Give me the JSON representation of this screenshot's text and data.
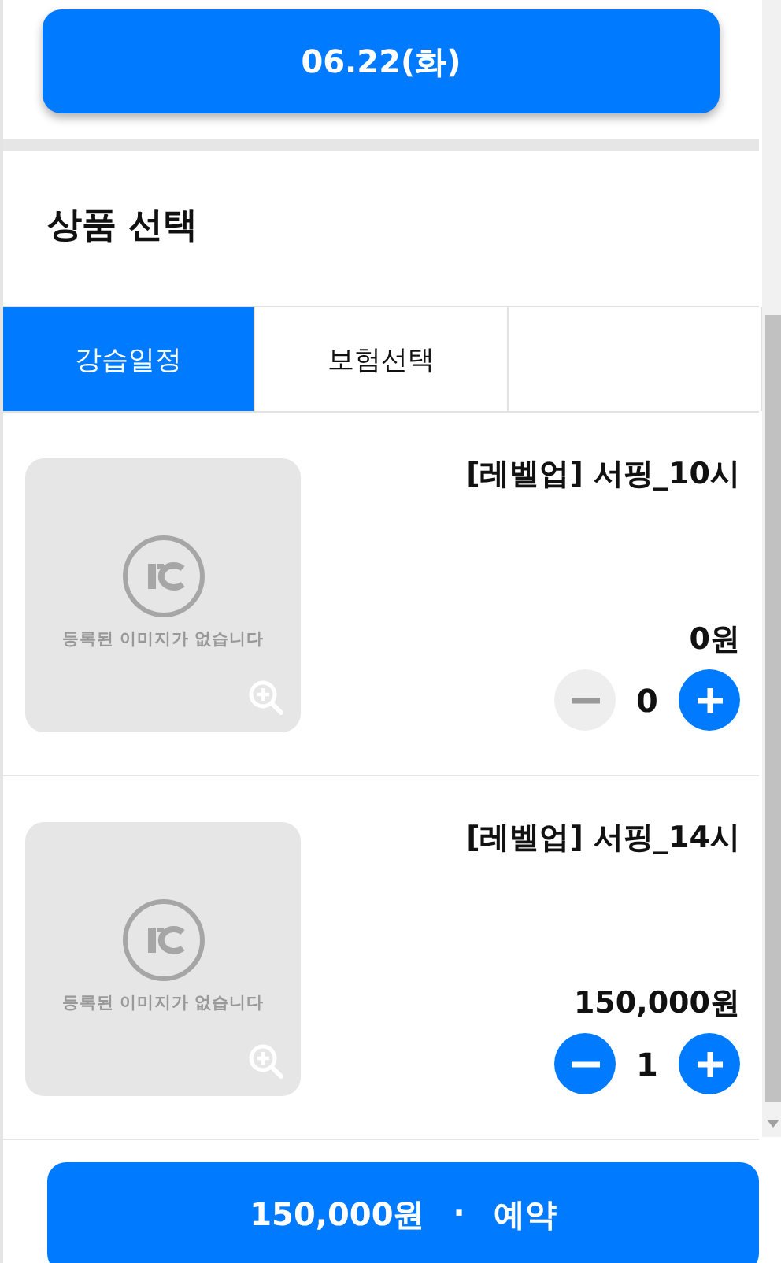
{
  "date_button": {
    "label": "06.22(화)"
  },
  "section_title": "상품 선택",
  "tabs": [
    {
      "label": "강습일정",
      "selected": true
    },
    {
      "label": "보험선택",
      "selected": false
    }
  ],
  "products": [
    {
      "image": {
        "kind": "placeholder",
        "text": "등록된 이미지가 없습니다"
      },
      "title": "[레벨업] 서핑_10시",
      "price": "0원",
      "quantity": "0",
      "minus_disabled": true
    },
    {
      "image": {
        "kind": "placeholder",
        "text": "등록된 이미지가 없습니다"
      },
      "title": "[레벨업] 서핑_14시",
      "price": "150,000원",
      "quantity": "1",
      "minus_disabled": false
    }
  ],
  "reserve_button": {
    "total": "150,000원",
    "separator": "·",
    "action": "예약"
  }
}
